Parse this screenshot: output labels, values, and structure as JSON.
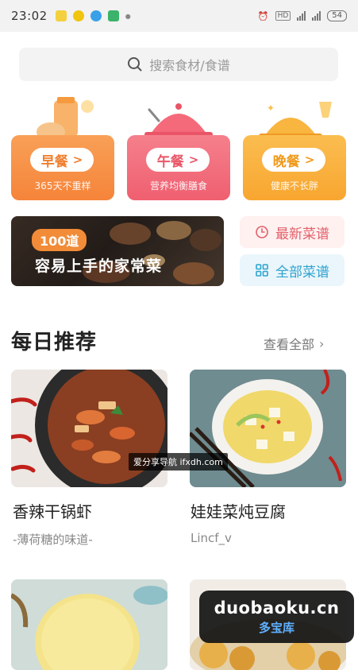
{
  "status_bar": {
    "time": "23:02",
    "battery": "54"
  },
  "search": {
    "placeholder": "搜索食材/食谱"
  },
  "meals": [
    {
      "label": "早餐",
      "subtitle": "365天不重样",
      "color": "#f7944a"
    },
    {
      "label": "午餐",
      "subtitle": "营养均衡膳食",
      "color": "#f26d7a"
    },
    {
      "label": "晚餐",
      "subtitle": "健康不长胖",
      "color": "#f9b23f"
    }
  ],
  "banner": {
    "badge": "100道",
    "title": "容易上手的家常菜"
  },
  "side_buttons": {
    "latest": "最新菜谱",
    "all": "全部菜谱"
  },
  "daily": {
    "title": "每日推荐",
    "view_all": "查看全部"
  },
  "recipes": [
    {
      "title": "香辣干锅虾",
      "author": "-薄荷糖的味道-"
    },
    {
      "title": "娃娃菜炖豆腐",
      "author": "Lincf_v"
    },
    {
      "title": "",
      "author": ""
    },
    {
      "title": "",
      "author": ""
    }
  ],
  "watermarks": {
    "small": "爱分享导航 ifxdh.com",
    "big_line1": "duobaoku.cn",
    "big_line2": "多宝库"
  }
}
